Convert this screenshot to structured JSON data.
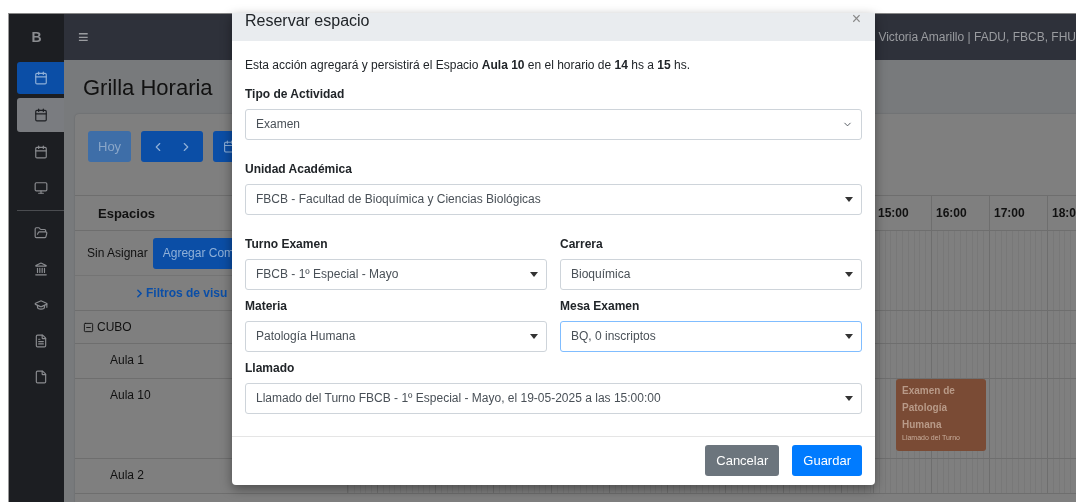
{
  "sidebar": {
    "brand": "B",
    "items": [
      {
        "kind": "calendar",
        "selected": true,
        "highlighted": false
      },
      {
        "kind": "calendar",
        "selected": false,
        "highlighted": true
      },
      {
        "kind": "calendar",
        "selected": false,
        "highlighted": false
      },
      {
        "kind": "monitor",
        "selected": false,
        "highlighted": false
      },
      {
        "kind": "folder",
        "selected": false,
        "highlighted": false
      },
      {
        "kind": "landmark",
        "selected": false,
        "highlighted": false
      },
      {
        "kind": "graduation",
        "selected": false,
        "highlighted": false
      },
      {
        "kind": "document",
        "selected": false,
        "highlighted": false
      },
      {
        "kind": "file",
        "selected": false,
        "highlighted": false
      }
    ]
  },
  "navbar": {
    "menu": "≡",
    "user": "Victoria Amarillo | FADU, FBCB, FHU"
  },
  "page": {
    "title": "Grilla Horaria"
  },
  "toolbar": {
    "today": {
      "label": "Hoy",
      "disabled": true
    }
  },
  "grid": {
    "spaces_header": "Espacios",
    "unassigned": "Sin Asignar",
    "add_button": "Agregar Com",
    "filters_link": "Filtros de visu",
    "times": [
      "15:00",
      "16:00",
      "17:00",
      "18:0"
    ],
    "rows": [
      {
        "name": "CUBO",
        "kind": "group",
        "expanded": true
      },
      {
        "name": "Aula 1",
        "kind": "room"
      },
      {
        "name": "Aula 10",
        "kind": "room",
        "events": [
          {
            "title": "Examen de Patología Humana",
            "subtitle": "Llamado del Turno",
            "color": "#7a4b35"
          }
        ]
      },
      {
        "name": "Aula 2",
        "kind": "room"
      }
    ]
  },
  "modal": {
    "title": "Reservar espacio",
    "close": "×",
    "intro": "Esta acción agregará y persistirá el Espacio **Aula 10** en el horario de **14** hs a **15** hs.",
    "rows": [
      [
        {
          "label": "Tipo de Actividad",
          "value": "Examen",
          "kind": "native",
          "focused": false
        }
      ],
      [
        {
          "label": "Unidad Académica",
          "value": "FBCB - Facultad de Bioquímica y Ciencias Biológicas",
          "kind": "dropdown",
          "focused": false
        }
      ],
      [
        {
          "label": "Turno Examen",
          "value": "FBCB - 1º Especial - Mayo",
          "kind": "dropdown",
          "focused": false
        },
        {
          "label": "Carrera",
          "value": "Bioquímica",
          "kind": "dropdown",
          "focused": false
        }
      ],
      [
        {
          "label": "Materia",
          "value": "Patología Humana",
          "kind": "dropdown",
          "focused": false
        },
        {
          "label": "Mesa Examen",
          "value": "BQ, 0 inscriptos",
          "kind": "dropdown",
          "focused": true
        }
      ],
      [
        {
          "label": "Llamado",
          "value": "Llamado del Turno FBCB - 1º Especial - Mayo, el 19-05-2025 a las 15:00:00",
          "kind": "dropdown",
          "focused": false
        }
      ]
    ],
    "buttons": [
      {
        "label": "Cancelar",
        "kind": "secondary"
      },
      {
        "label": "Guardar",
        "kind": "primary"
      }
    ]
  }
}
